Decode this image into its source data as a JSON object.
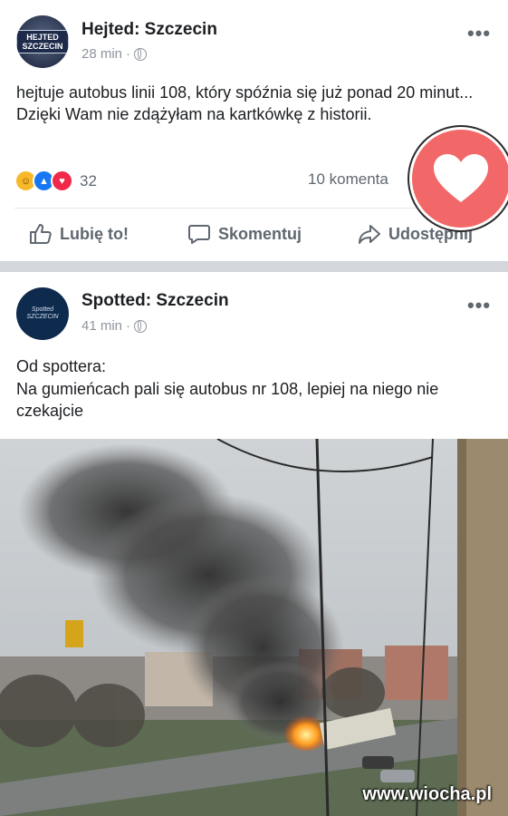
{
  "post1": {
    "author": "Hejted: Szczecin",
    "avatar_text": "HEJTED SZCZECIN",
    "time": "28 min",
    "more": "•••",
    "text": "hejtuje autobus linii 108, który spóźnia się już ponad 20 minut... Dzięki Wam nie zdążyłam na kartkówkę z historii.",
    "reaction_count": "32",
    "reaction_icons": [
      "haha-icon",
      "like-icon",
      "love-icon"
    ],
    "comments": "10 komenta",
    "actions": {
      "like": "Lubię to!",
      "comment": "Skomentuj",
      "share": "Udostępnij"
    }
  },
  "post2": {
    "author": "Spotted: Szczecin",
    "avatar_text": "Spotted SZCZECIN",
    "time": "41 min",
    "more": "•••",
    "text_line1": "Od spottera:",
    "text_line2": "Na gumieńcach pali się autobus nr 108, lepiej na niego nie czekajcie"
  },
  "watermark": "www.wiocha.pl",
  "colors": {
    "facebook_blue": "#1877f2",
    "love_red": "#f26767",
    "separator": "#d3d6db"
  }
}
